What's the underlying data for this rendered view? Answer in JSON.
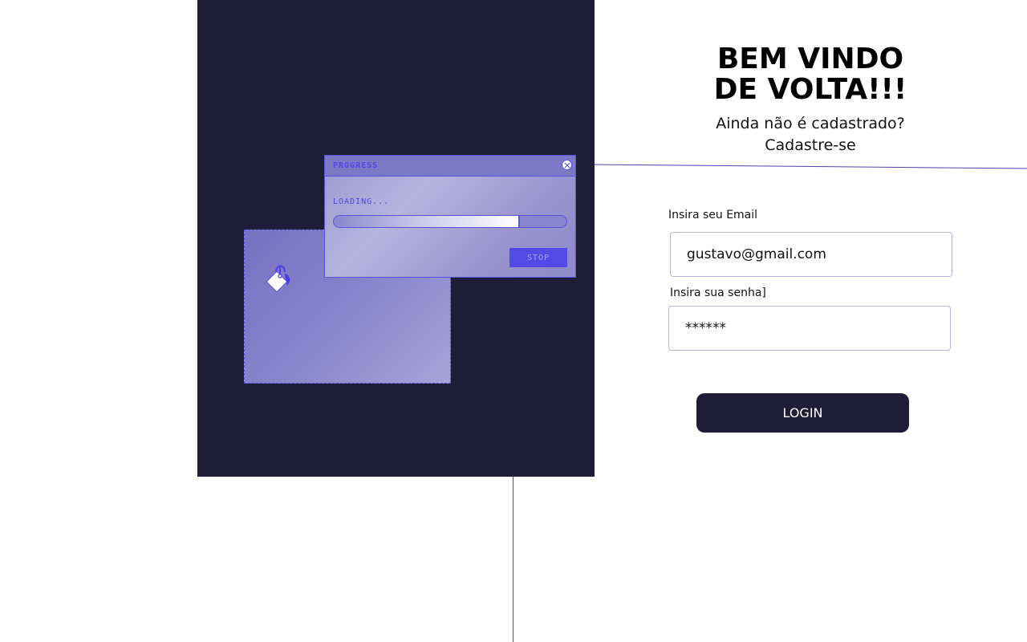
{
  "illustration": {
    "progress_window": {
      "title": "PROGRESS",
      "status_text": "LOADING...",
      "progress_fraction": 0.8,
      "stop_label": "STOP",
      "close_icon": "close-icon"
    },
    "paint_bucket_icon": "paint-bucket-icon",
    "colors": {
      "panel_background": "#1e1c37",
      "accent": "#5249e6",
      "window_fill": "#8a84cc"
    }
  },
  "login": {
    "title": "BEM VINDO DE VOLTA!!!",
    "signup_question": "Ainda não é cadastrado?",
    "signup_link": "Cadastre-se",
    "email": {
      "label": "Insira seu Email",
      "value": "gustavo@gmail.com"
    },
    "password": {
      "label": "Insira sua senha]",
      "value": "******"
    },
    "login_button": "LOGIN",
    "colors": {
      "button_background": "#1e1c37",
      "input_border": "#b7b3e6"
    }
  }
}
